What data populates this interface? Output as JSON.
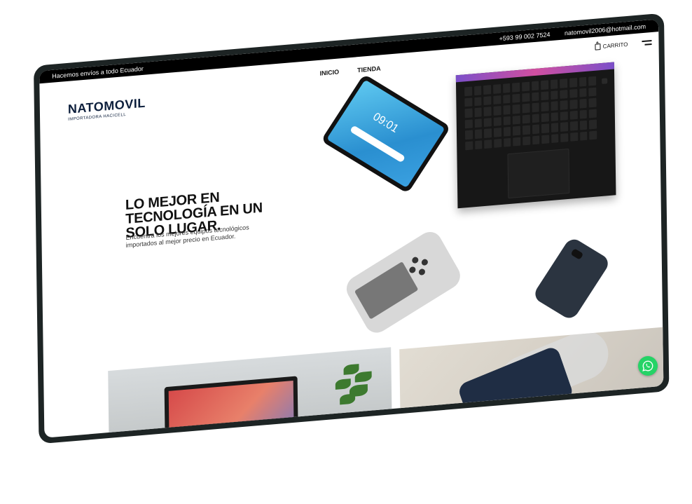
{
  "topbar": {
    "shipping_text": "Hacemos envíos a todo Ecuador",
    "phone": "+593 99 002 7524",
    "email": "natomovil2006@hotmail.com"
  },
  "brand": {
    "name": "NATOMOVIL",
    "tagline": "IMPORTADORA HACICELL"
  },
  "nav": {
    "links": [
      "INICIO",
      "TIENDA"
    ],
    "cart_label": "CARRITO",
    "menu_icon": "hamburger-menu-icon",
    "cart_icon": "shopping-bag-icon"
  },
  "hero": {
    "title": "LO MEJOR EN TECNOLOGÍA EN UN SOLO LUGAR.",
    "description": "Encuentra los mejores equipos tecnológicos importados al mejor precio en Ecuador."
  },
  "tablet": {
    "clock": "09:01"
  },
  "colors": {
    "topbar_bg": "#000000",
    "brand_navy": "#0d1f3c",
    "frame": "#1d2424",
    "whatsapp": "#25d366"
  },
  "floating": {
    "whatsapp_icon": "whatsapp-icon"
  }
}
